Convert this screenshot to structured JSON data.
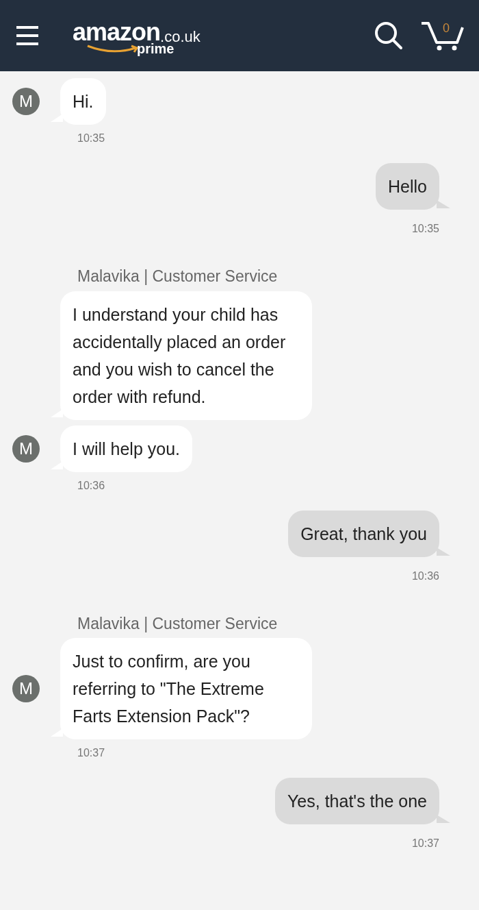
{
  "header": {
    "logo": {
      "word": "amazon",
      "domain": ".co.uk",
      "tier": "prime"
    },
    "cart_count": "0"
  },
  "messages": [
    {
      "kind": "agent",
      "avatar": "M",
      "bubbles": [
        "Hi."
      ],
      "time": "10:35"
    },
    {
      "kind": "user",
      "bubbles": [
        "Hello"
      ],
      "time": "10:35"
    },
    {
      "kind": "agent",
      "sender": "Malavika | Customer Service",
      "avatar": "M",
      "bubbles": [
        "I understand your child has accidentally placed an order and you wish to cancel the order with refund.",
        "I will help you."
      ],
      "time": "10:36"
    },
    {
      "kind": "user",
      "bubbles": [
        "Great, thank you"
      ],
      "time": "10:36"
    },
    {
      "kind": "agent",
      "sender": "Malavika | Customer Service",
      "avatar": "M",
      "bubbles": [
        "Just to confirm, are you referring to \"The Extreme Farts Extension Pack\"?"
      ],
      "time": "10:37"
    },
    {
      "kind": "user",
      "bubbles": [
        "Yes, that's the one"
      ],
      "time": "10:37"
    }
  ]
}
